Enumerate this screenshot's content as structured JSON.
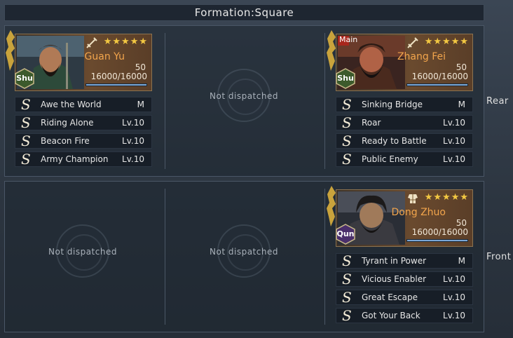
{
  "formation": {
    "title": "Formation:Square"
  },
  "row_labels": {
    "rear": "Rear",
    "front": "Front"
  },
  "empty_text": "Not dispatched",
  "icons": {
    "star": "★",
    "skill_grade": "S"
  },
  "generals": {
    "guan_yu": {
      "name": "Guan Yu",
      "faction": "Shu",
      "faction_color": "#3c5a2c",
      "level": "50",
      "troops": "16000/16000",
      "troop_fraction": 1.0,
      "stars": 5,
      "weapon_icon": "sword-icon",
      "skills": [
        {
          "grade": "S",
          "name": "Awe the World",
          "level": "M"
        },
        {
          "grade": "S",
          "name": "Riding Alone",
          "level": "Lv.10"
        },
        {
          "grade": "S",
          "name": "Beacon Fire",
          "level": "Lv.10"
        },
        {
          "grade": "S",
          "name": "Army Champion",
          "level": "Lv.10"
        }
      ]
    },
    "zhang_fei": {
      "name": "Zhang Fei",
      "faction": "Shu",
      "faction_color": "#3c5a2c",
      "main_tag": "Main",
      "level": "50",
      "troops": "16000/16000",
      "troop_fraction": 1.0,
      "stars": 5,
      "weapon_icon": "sword-icon",
      "skills": [
        {
          "grade": "S",
          "name": "Sinking Bridge",
          "level": "M"
        },
        {
          "grade": "S",
          "name": "Roar",
          "level": "Lv.10"
        },
        {
          "grade": "S",
          "name": "Ready to Battle",
          "level": "Lv.10"
        },
        {
          "grade": "S",
          "name": "Public Enemy",
          "level": "Lv.10"
        }
      ]
    },
    "dong_zhuo": {
      "name": "Dong Zhuo",
      "faction": "Qun",
      "faction_color": "#4a2f6b",
      "level": "50",
      "troops": "16000/16000",
      "troop_fraction": 1.0,
      "stars": 5,
      "weapon_icon": "armor-icon",
      "skills": [
        {
          "grade": "S",
          "name": "Tyrant in Power",
          "level": "M"
        },
        {
          "grade": "S",
          "name": "Vicious Enabler",
          "level": "Lv.10"
        },
        {
          "grade": "S",
          "name": "Great Escape",
          "level": "Lv.10"
        },
        {
          "grade": "S",
          "name": "Got Your Back",
          "level": "Lv.10"
        }
      ]
    }
  },
  "colors": {
    "general_name": "#f2a54c",
    "star": "#f3c842",
    "troop_bar": "#7aa7d6",
    "main_tag": "#a8261c"
  }
}
